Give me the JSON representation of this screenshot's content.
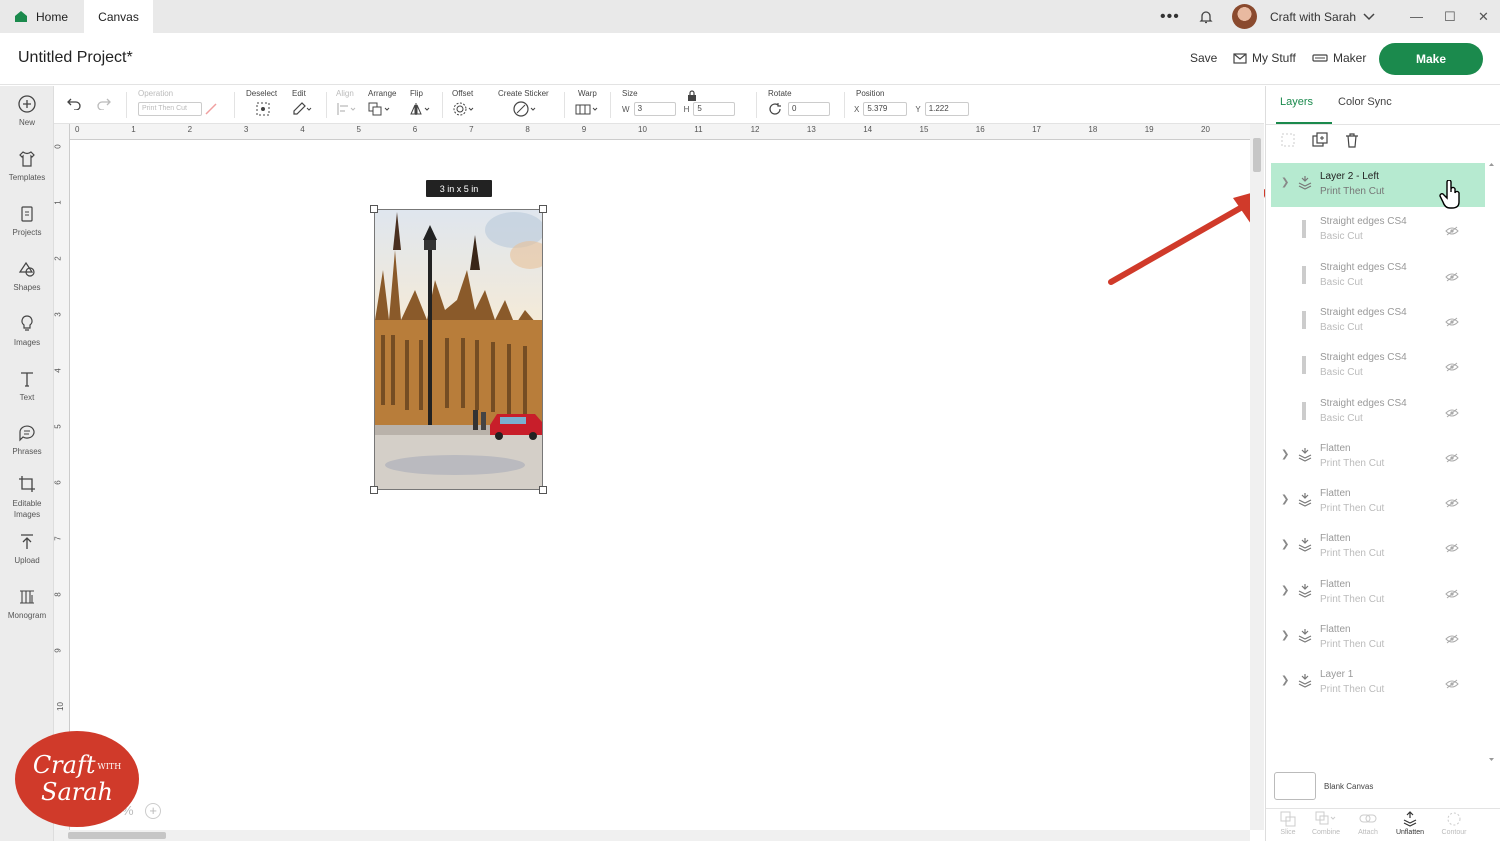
{
  "tabs": {
    "home": "Home",
    "canvas": "Canvas"
  },
  "topbar": {
    "more": "•••",
    "user_name": "Craft with Sarah"
  },
  "header": {
    "project_title": "Untitled Project*",
    "save": "Save",
    "my_stuff": "My Stuff",
    "maker": "Maker",
    "make": "Make"
  },
  "sidebar": [
    {
      "label": "New",
      "icon": "plus-circle-icon"
    },
    {
      "label": "Templates",
      "icon": "shirt-icon"
    },
    {
      "label": "Projects",
      "icon": "clipboard-icon"
    },
    {
      "label": "Shapes",
      "icon": "shapes-icon"
    },
    {
      "label": "Images",
      "icon": "lightbulb-icon"
    },
    {
      "label": "Text",
      "icon": "text-icon"
    },
    {
      "label": "Phrases",
      "icon": "speech-bubble-icon"
    },
    {
      "label": "Editable Images",
      "icon": "crop-icon"
    },
    {
      "label": "Upload",
      "icon": "upload-icon"
    },
    {
      "label": "Monogram",
      "icon": "monogram-icon"
    }
  ],
  "toolbar": {
    "operation_label": "Operation",
    "operation_value": "Print Then Cut",
    "deselect": "Deselect",
    "edit": "Edit",
    "align": "Align",
    "arrange": "Arrange",
    "flip": "Flip",
    "offset": "Offset",
    "create_sticker": "Create Sticker",
    "warp": "Warp",
    "size": "Size",
    "w_label": "W",
    "w_value": "3",
    "h_label": "H",
    "h_value": "5",
    "rotate": "Rotate",
    "rotate_value": "0",
    "position": "Position",
    "x_label": "X",
    "x_value": "5.379",
    "y_label": "Y",
    "y_value": "1.222"
  },
  "ruler": {
    "h": [
      "0",
      "1",
      "2",
      "3",
      "4",
      "5",
      "6",
      "7",
      "8",
      "9",
      "10",
      "11",
      "12",
      "13",
      "14",
      "15",
      "16",
      "17",
      "18",
      "19",
      "20"
    ],
    "v": [
      "0",
      "1",
      "2",
      "3",
      "4",
      "5",
      "6",
      "7",
      "8",
      "9",
      "10"
    ]
  },
  "canvas": {
    "size_tag": "3  in x 5  in"
  },
  "panel": {
    "tab_layers": "Layers",
    "tab_color_sync": "Color Sync",
    "layers": [
      {
        "name": "Layer 2 - Left",
        "op": "Print Then Cut",
        "type": "group",
        "selected": true
      },
      {
        "name": "Straight edges CS4",
        "op": "Basic Cut",
        "type": "shape"
      },
      {
        "name": "Straight edges CS4",
        "op": "Basic Cut",
        "type": "shape"
      },
      {
        "name": "Straight edges CS4",
        "op": "Basic Cut",
        "type": "shape"
      },
      {
        "name": "Straight edges CS4",
        "op": "Basic Cut",
        "type": "shape"
      },
      {
        "name": "Straight edges CS4",
        "op": "Basic Cut",
        "type": "shape"
      },
      {
        "name": "Flatten",
        "op": "Print Then Cut",
        "type": "group"
      },
      {
        "name": "Flatten",
        "op": "Print Then Cut",
        "type": "group"
      },
      {
        "name": "Flatten",
        "op": "Print Then Cut",
        "type": "group"
      },
      {
        "name": "Flatten",
        "op": "Print Then Cut",
        "type": "group"
      },
      {
        "name": "Flatten",
        "op": "Print Then Cut",
        "type": "group"
      },
      {
        "name": "Layer 1",
        "op": "Print Then Cut",
        "type": "group"
      }
    ],
    "blank_canvas": "Blank Canvas",
    "bottom_tools": [
      "Slice",
      "Combine",
      "Attach",
      "Unflatten",
      "Contour"
    ]
  },
  "logo": {
    "line1": "Craft",
    "with": "WITH",
    "line2": "Sarah"
  },
  "zoom": "%",
  "colors": {
    "accent": "#1b8a4d",
    "selected_row": "#b6ead0",
    "arrow": "#d03a2a",
    "logo_bg": "#d03a2a"
  }
}
